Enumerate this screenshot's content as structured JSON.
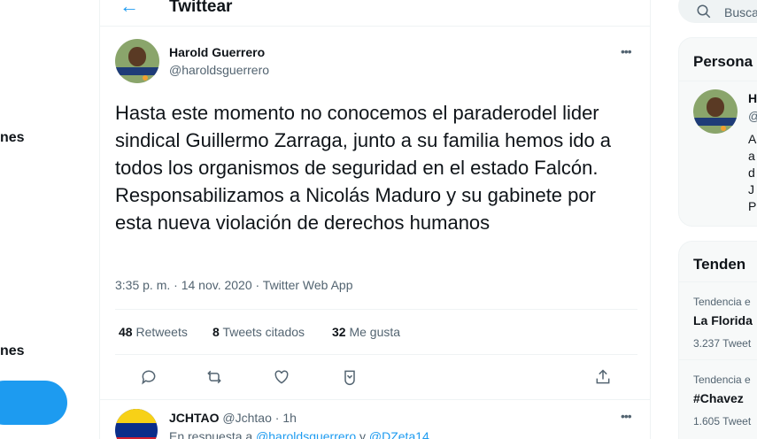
{
  "nav": {
    "frag1": "nes",
    "frag2": "nes"
  },
  "header": {
    "title": "Twittear"
  },
  "tweet": {
    "author_name": "Harold Guerrero",
    "author_handle": "@haroldsguerrero",
    "text": "Hasta este momento no conocemos el paraderodel lider sindical Guillermo Zarraga, junto a su familia hemos ido a todos los organismos de seguridad en el estado Falcón. Responsabilizamos a Nicolás Maduro y su gabinete por esta nueva violación de derechos humanos",
    "meta": "3:35 p. m. · 14 nov. 2020 · Twitter Web App",
    "stats": {
      "retweets_count": "48",
      "retweets_label": "Retweets",
      "quotes_count": "8",
      "quotes_label": "Tweets citados",
      "likes_count": "32",
      "likes_label": "Me gusta"
    },
    "more_icon": "more-horizontal-icon"
  },
  "reply": {
    "name": "JCHTAO",
    "handle_time": "@Jchtao · 1h",
    "reply_prefix": "En respuesta a",
    "mention1": "@haroldsguerrero",
    "conjunction": "y",
    "mention2": "@DZeta14"
  },
  "sidebar": {
    "search_placeholder": "Busca",
    "profile_panel": {
      "title": "Persona",
      "name_fragment": "H",
      "handle_fragment": "@",
      "bio_lines": [
        "A",
        "a",
        "d",
        "J",
        "P"
      ]
    },
    "trends_panel": {
      "title": "Tenden",
      "trends": [
        {
          "context": "Tendencia e",
          "name": "La Florida",
          "count": "3.237 Tweet"
        },
        {
          "context": "Tendencia e",
          "name": "#Chavez",
          "count": "1.605 Tweet"
        }
      ]
    }
  },
  "colors": {
    "accent": "#1d9bf0",
    "text": "#0f1419",
    "secondary": "#536471",
    "border": "#eff3f4"
  }
}
